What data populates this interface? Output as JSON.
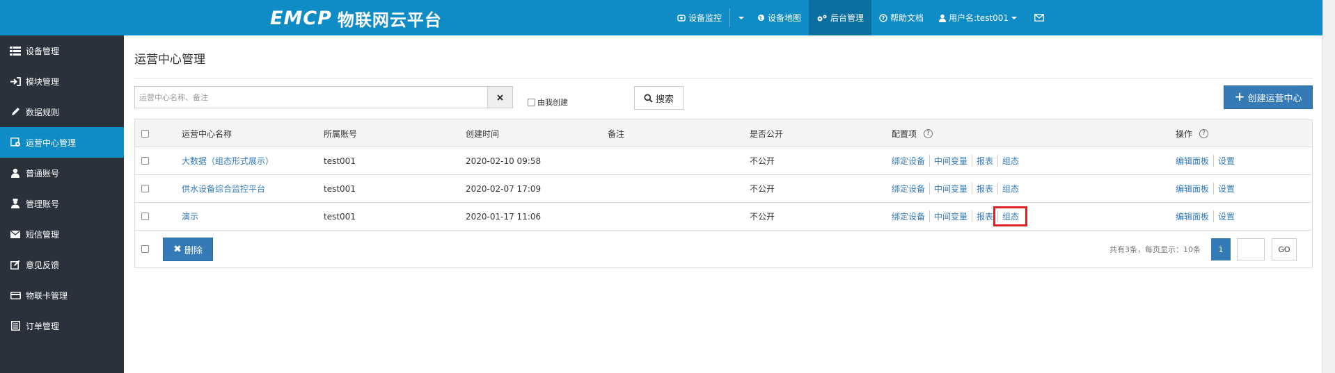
{
  "brand": {
    "mark": "EMCP",
    "name": "物联网云平台"
  },
  "nav": {
    "items": [
      {
        "label": "设备监控",
        "icon": "eye-icon"
      },
      {
        "label": "设备地图",
        "icon": "globe-icon"
      },
      {
        "label": "后台管理",
        "icon": "gears-icon",
        "active": true
      },
      {
        "label": "帮助文档",
        "icon": "question-circle-icon"
      },
      {
        "label": "用户名:test001",
        "icon": "user-icon"
      }
    ]
  },
  "sidebar": {
    "items": [
      {
        "label": "设备管理",
        "icon": "list-icon"
      },
      {
        "label": "模块管理",
        "icon": "sign-in-icon"
      },
      {
        "label": "数据规则",
        "icon": "pencil-icon"
      },
      {
        "label": "运营中心管理",
        "icon": "cog-box-icon",
        "active": true
      },
      {
        "label": "普通账号",
        "icon": "user-icon"
      },
      {
        "label": "管理账号",
        "icon": "admin-user-icon"
      },
      {
        "label": "短信管理",
        "icon": "envelope-icon"
      },
      {
        "label": "意见反馈",
        "icon": "edit-icon"
      },
      {
        "label": "物联卡管理",
        "icon": "credit-card-icon"
      },
      {
        "label": "订单管理",
        "icon": "order-list-icon"
      }
    ]
  },
  "page": {
    "title": "运营中心管理",
    "search_placeholder": "运营中心名称、备注",
    "mine_label": "由我创建",
    "search_label": "搜索",
    "create_label": "创建运营中心"
  },
  "table": {
    "headers": {
      "name": "运营中心名称",
      "account": "所属账号",
      "created": "创建时间",
      "note": "备注",
      "public": "是否公开",
      "config": "配置项",
      "ops": "操作"
    },
    "config_links": [
      "绑定设备",
      "中间变量",
      "报表",
      "组态"
    ],
    "op_links": [
      "编辑面板",
      "设置"
    ],
    "rows": [
      {
        "name": "大数据（组态形式展示）",
        "account": "test001",
        "created": "2020-02-10 09:58",
        "note": "",
        "public": "不公开"
      },
      {
        "name": "供水设备综合监控平台",
        "account": "test001",
        "created": "2020-02-07 17:09",
        "note": "",
        "public": "不公开"
      },
      {
        "name": "演示",
        "account": "test001",
        "created": "2020-01-17 11:06",
        "note": "",
        "public": "不公开"
      }
    ]
  },
  "footer": {
    "delete_label": "删除",
    "summary": "共有3条，每页显示：10条",
    "current_page": "1",
    "go_label": "GO"
  },
  "colors": {
    "topbar": "#0f8bc6",
    "sidebar": "#2a313a",
    "primary": "#337ab7",
    "highlight": "#e02020"
  }
}
